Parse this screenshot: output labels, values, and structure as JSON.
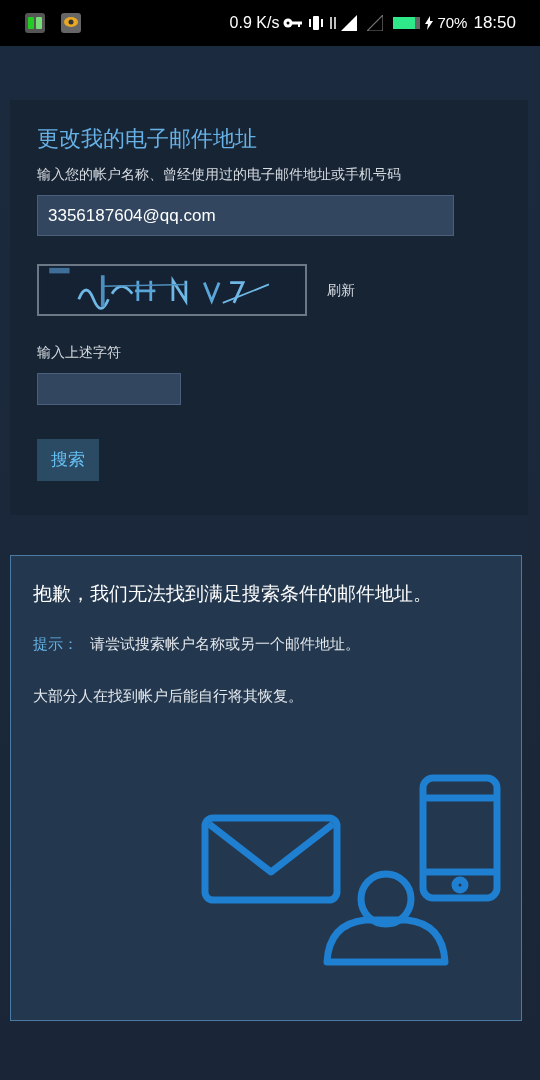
{
  "status_bar": {
    "speed": "0.9 K/s",
    "battery": "70%",
    "time": "18:50"
  },
  "form": {
    "title": "更改我的电子邮件地址",
    "account_label": "输入您的帐户名称、曾经使用过的电子邮件地址或手机号码",
    "account_value": "3356187604@qq.com",
    "refresh": "刷新",
    "captcha_label": "输入上述字符",
    "search_button": "搜索"
  },
  "result": {
    "title": "抱歉，我们无法找到满足搜索条件的邮件地址。",
    "hint_label": "提示：",
    "hint_text": "请尝试搜索帐户名称或另一个邮件地址。",
    "note": "大部分人在找到帐户后能自行将其恢复。"
  }
}
